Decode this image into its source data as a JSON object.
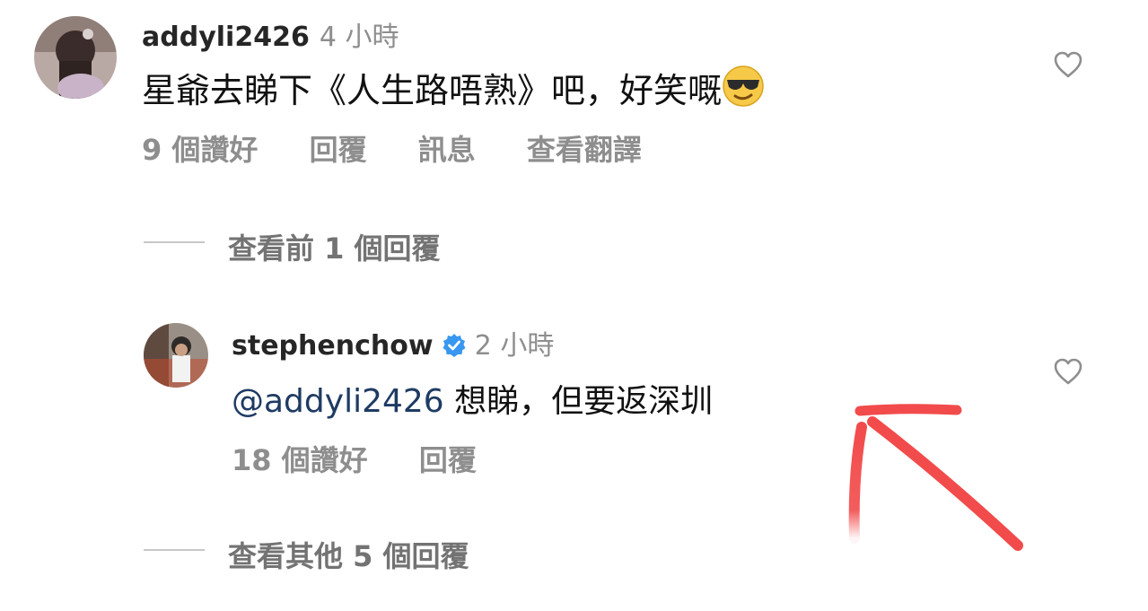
{
  "comments": [
    {
      "username": "addyli2426",
      "time": "4 小時",
      "text": "星爺去睇下《人生路唔熟》吧，好笑嘅",
      "emoji_icon": "sunglasses-emoji",
      "likes": "9 個讚好",
      "reply": "回覆",
      "message": "訊息",
      "translate": "查看翻譯"
    },
    {
      "username": "stephenchow",
      "verified_icon": "verified-badge-icon",
      "time": "2 小時",
      "mention": "@addyli2426",
      "text": " 想睇，但要返深圳",
      "likes": "18 個讚好",
      "reply": "回覆"
    }
  ],
  "view_previous": "查看前 1 個回覆",
  "view_more": "查看其他 5 個回覆",
  "colors": {
    "verified": "#3897f0",
    "annotation_arrow": "#f24b4b",
    "muted_text": "#8e8e8e"
  }
}
